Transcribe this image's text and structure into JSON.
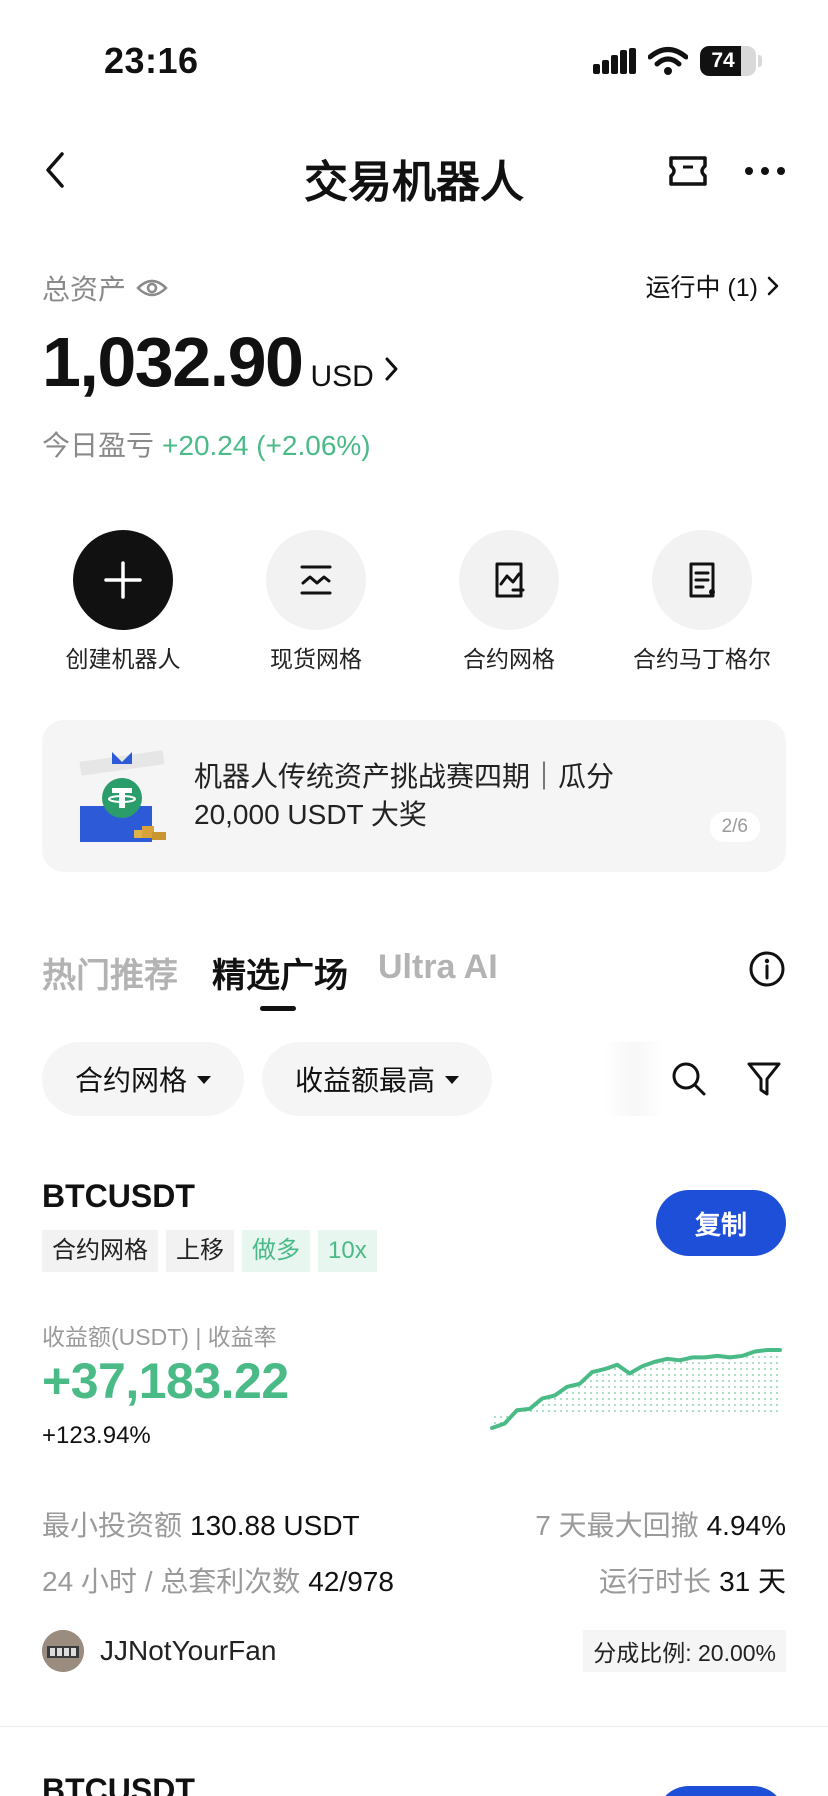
{
  "status_bar": {
    "time": "23:16",
    "battery": "74"
  },
  "header": {
    "title": "交易机器人"
  },
  "assets": {
    "label": "总资产",
    "running": "运行中 (1)",
    "amount": "1,032.90",
    "currency": "USD",
    "today_label": "今日盈亏",
    "today_pnl": "+20.24 (+2.06%)"
  },
  "actions": [
    {
      "label": "创建机器人",
      "icon": "plus-icon"
    },
    {
      "label": "现货网格",
      "icon": "spot-grid-icon"
    },
    {
      "label": "合约网格",
      "icon": "futures-grid-icon"
    },
    {
      "label": "合约马丁格尔",
      "icon": "martingale-icon"
    }
  ],
  "banner": {
    "text": "机器人传统资产挑战赛四期｜瓜分 20,000 USDT 大奖",
    "pager": "2/6"
  },
  "tabs": [
    {
      "label": "热门推荐",
      "active": false
    },
    {
      "label": "精选广场",
      "active": true
    },
    {
      "label": "Ultra AI",
      "active": false
    }
  ],
  "filters": {
    "type": "合约网格",
    "sort": "收益额最高"
  },
  "card": {
    "pair": "BTCUSDT",
    "tags": [
      {
        "label": "合约网格",
        "style": "gray"
      },
      {
        "label": "上移",
        "style": "gray"
      },
      {
        "label": "做多",
        "style": "green"
      },
      {
        "label": "10x",
        "style": "green"
      }
    ],
    "copy": "复制",
    "profit_label": "收益额(USDT) | 收益率",
    "profit": "+37,183.22",
    "rate": "+123.94%",
    "min_invest_label": "最小投资额",
    "min_invest": "130.88 USDT",
    "drawdown_label": "7 天最大回撤",
    "drawdown": "4.94%",
    "arb_label": "24 小时 / 总套利次数",
    "arb": "42/978",
    "runtime_label": "运行时长",
    "runtime": "31 天",
    "owner": "JJNotYourFan",
    "share": "分成比例: 20.00%",
    "sparkline": [
      0,
      3,
      12,
      13,
      20,
      22,
      28,
      30,
      38,
      40,
      43,
      37,
      42,
      45,
      47,
      46,
      48,
      48,
      49,
      48,
      49,
      52,
      53,
      53
    ]
  },
  "next_card": {
    "pair": "BTCUSDT"
  },
  "colors": {
    "green": "#4aba86",
    "blue": "#1e4fd8"
  }
}
